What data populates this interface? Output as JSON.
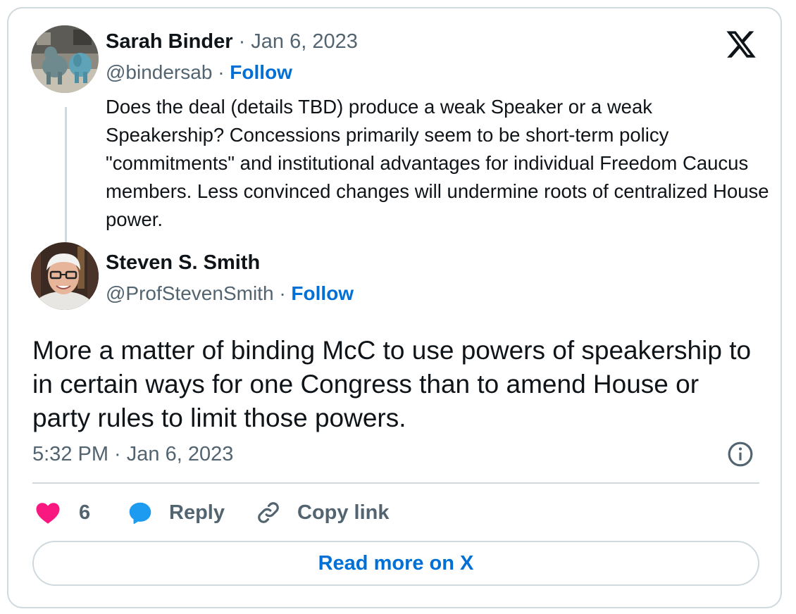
{
  "quoted_tweet": {
    "author_name": "Sarah Binder",
    "date": "Jan 6, 2023",
    "handle": "@bindersab",
    "follow_label": "Follow",
    "text": "Does the deal (details TBD) produce a weak Speaker or a weak Speakership? Concessions primarily seem to be short-term policy \"commitments\" and institutional advantages for individual Freedom Caucus members. Less convinced changes will undermine roots of centralized House power."
  },
  "reply_tweet": {
    "author_name": "Steven S. Smith",
    "handle": "@ProfStevenSmith",
    "follow_label": "Follow",
    "text": "More a matter of binding McC to use powers of speakership to in certain ways for one Congress than to amend House or party rules to limit those powers.",
    "timestamp": "5:32 PM · Jan 6, 2023"
  },
  "actions": {
    "like_count": "6",
    "reply_label": "Reply",
    "copy_link_label": "Copy link"
  },
  "read_more_label": "Read more on X",
  "icons": {
    "brand": "x-logo-icon",
    "info": "info-icon",
    "like": "heart-icon",
    "reply": "speech-bubble-icon",
    "copy": "link-icon"
  },
  "colors": {
    "link_blue": "#006fd6",
    "heart_pink": "#f91880",
    "reply_blue": "#1d9bf0",
    "muted_text": "#536471",
    "border": "#cfd9de"
  }
}
